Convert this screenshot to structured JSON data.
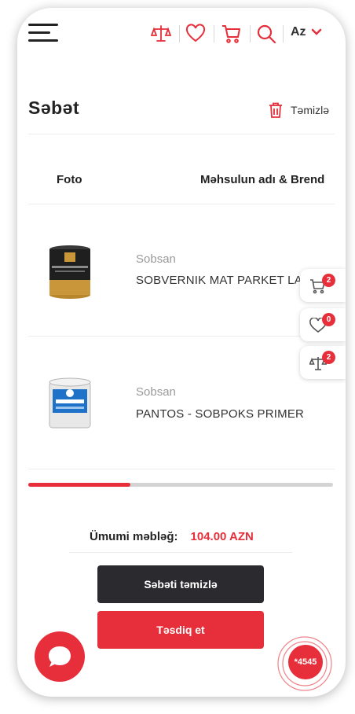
{
  "header": {
    "icons": [
      "menu-icon",
      "compare-icon",
      "heart-icon",
      "cart-icon",
      "search-icon"
    ],
    "language": "Az"
  },
  "cart": {
    "title": "Səbət",
    "clear_label": "Təmizlə",
    "columns": {
      "photo": "Foto",
      "name_brand": "Məhsulun adı & Brend"
    },
    "items": [
      {
        "brand": "Sobsan",
        "name": "SOBVERNIK MAT PARKET LA"
      },
      {
        "brand": "Sobsan",
        "name": "PANTOS - SOBPOKS PRIMER"
      }
    ],
    "total_label": "Ümumi məbləğ:",
    "total_value": "104.00 AZN",
    "clear_cart_button": "Səbəti təmizlə",
    "confirm_button": "Təsdiq et"
  },
  "floating": {
    "cart_count": "2",
    "wishlist_count": "0",
    "compare_count": "2"
  },
  "callcenter": {
    "number": "*4545"
  },
  "colors": {
    "accent": "#e62f3a",
    "dark_button": "#2a2a2f"
  }
}
